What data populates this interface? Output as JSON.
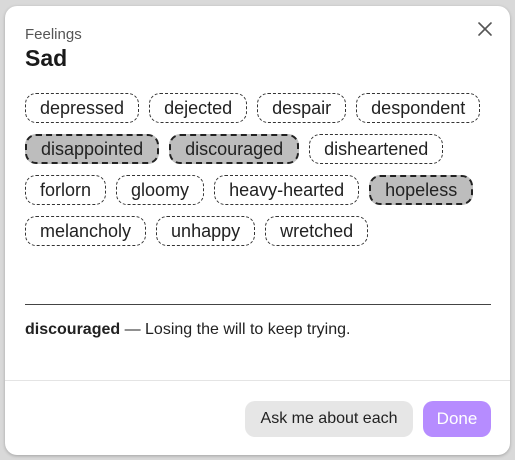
{
  "dialog": {
    "eyebrow": "Feelings",
    "title": "Sad",
    "close_icon": "close-icon"
  },
  "chips": [
    {
      "label": "depressed",
      "selected": false
    },
    {
      "label": "dejected",
      "selected": false
    },
    {
      "label": "despair",
      "selected": false
    },
    {
      "label": "despondent",
      "selected": false
    },
    {
      "label": "disappointed",
      "selected": true
    },
    {
      "label": "discouraged",
      "selected": true
    },
    {
      "label": "disheartened",
      "selected": false
    },
    {
      "label": "forlorn",
      "selected": false
    },
    {
      "label": "gloomy",
      "selected": false
    },
    {
      "label": "heavy-hearted",
      "selected": false
    },
    {
      "label": "hopeless",
      "selected": true
    },
    {
      "label": "melancholy",
      "selected": false
    },
    {
      "label": "unhappy",
      "selected": false
    },
    {
      "label": "wretched",
      "selected": false
    }
  ],
  "definition": {
    "term": "discouraged",
    "separator": " — ",
    "text": "Losing the will to keep trying."
  },
  "footer": {
    "ask_label": "Ask me about each",
    "done_label": "Done"
  },
  "colors": {
    "accent": "#b68cff",
    "selected_chip": "#bdbdbd"
  }
}
